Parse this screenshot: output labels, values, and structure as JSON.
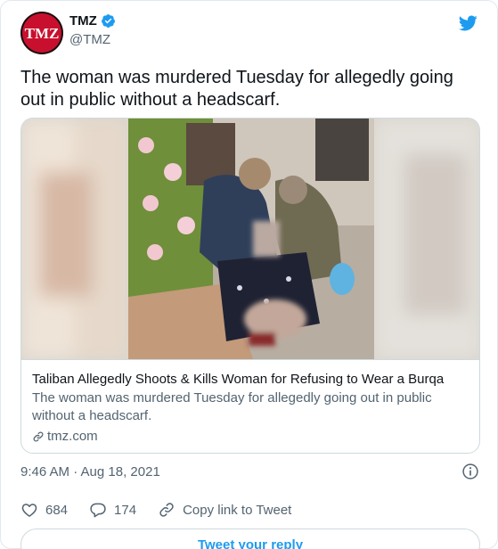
{
  "author": {
    "name": "TMZ",
    "handle": "@TMZ",
    "avatar_text": "TMZ"
  },
  "tweet": {
    "text": "The woman was murdered Tuesday for allegedly going out in public without a headscarf."
  },
  "card": {
    "title": "Taliban Allegedly Shoots & Kills Woman for Refusing to Wear a Burqa",
    "description": "The woman was murdered Tuesday for allegedly going out in public without a headscarf.",
    "domain": "tmz.com"
  },
  "meta": {
    "timestamp": "9:46 AM · Aug 18, 2021"
  },
  "actions": {
    "likes": "684",
    "replies": "174",
    "copy_link_label": "Copy link to Tweet"
  },
  "reply_button": {
    "label": "Tweet your reply"
  },
  "colors": {
    "brand_blue": "#1d9bf0",
    "tmz_red": "#c8102e",
    "secondary_text": "#536471"
  },
  "icons": {
    "twitter": "twitter-bird-icon",
    "verified": "verified-badge-icon",
    "info": "info-icon",
    "like": "heart-icon",
    "reply": "reply-bubble-icon",
    "link": "link-icon"
  }
}
